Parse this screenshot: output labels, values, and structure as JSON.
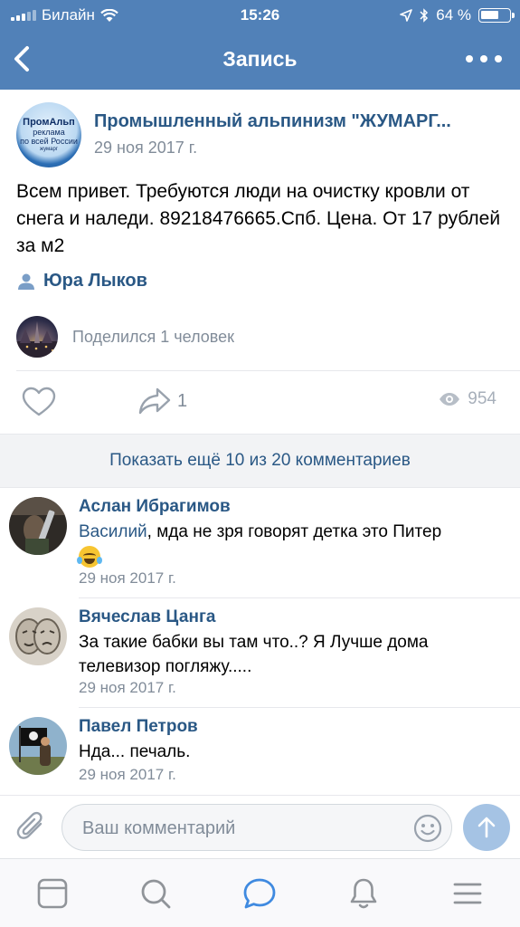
{
  "status_bar": {
    "carrier": "Билайн",
    "time": "15:26",
    "battery": "64 %",
    "battery_level": 0.64
  },
  "header": {
    "title": "Запись"
  },
  "post": {
    "group_name": "Промышленный альпинизм \"ЖУМАРГ...",
    "group_avatar_text": {
      "line1": "ПромАльп",
      "line2": "реклама",
      "line3": "по всей России",
      "line4": "жумарг"
    },
    "date": "29 ноя 2017 г.",
    "text": "Всем привет. Требуются люди на очистку кровли от снега и наледи. 89218476665.Спб. Цена. От 17 рублей за м2",
    "signer": "Юра Лыков",
    "shared_by": "Поделился 1 человек",
    "reposts": "1",
    "views": "954"
  },
  "show_more": "Показать ещё 10 из 20 комментариев",
  "comments": [
    {
      "author": "Аслан Ибрагимов",
      "mention": "Василий",
      "text": ", мда не зря говорят детка это Питер",
      "date": "29 ноя 2017 г."
    },
    {
      "author": "Вячеслав Цанга",
      "text": "За такие бабки вы там что..? Я Лучше дома телевизор погляжу.....",
      "date": "29 ноя 2017 г."
    },
    {
      "author": "Павел Петров",
      "text": "Нда... печаль.",
      "date": "29 ноя 2017 г."
    }
  ],
  "comment_input": {
    "placeholder": "Ваш комментарий",
    "value": ""
  },
  "colors": {
    "header": "#5181b8",
    "link": "#2a5885",
    "secondary": "#818c99",
    "send_button": "#a5c3e4"
  },
  "tabs": [
    "news-icon",
    "search-icon",
    "messages-icon",
    "notifications-icon",
    "menu-icon"
  ]
}
